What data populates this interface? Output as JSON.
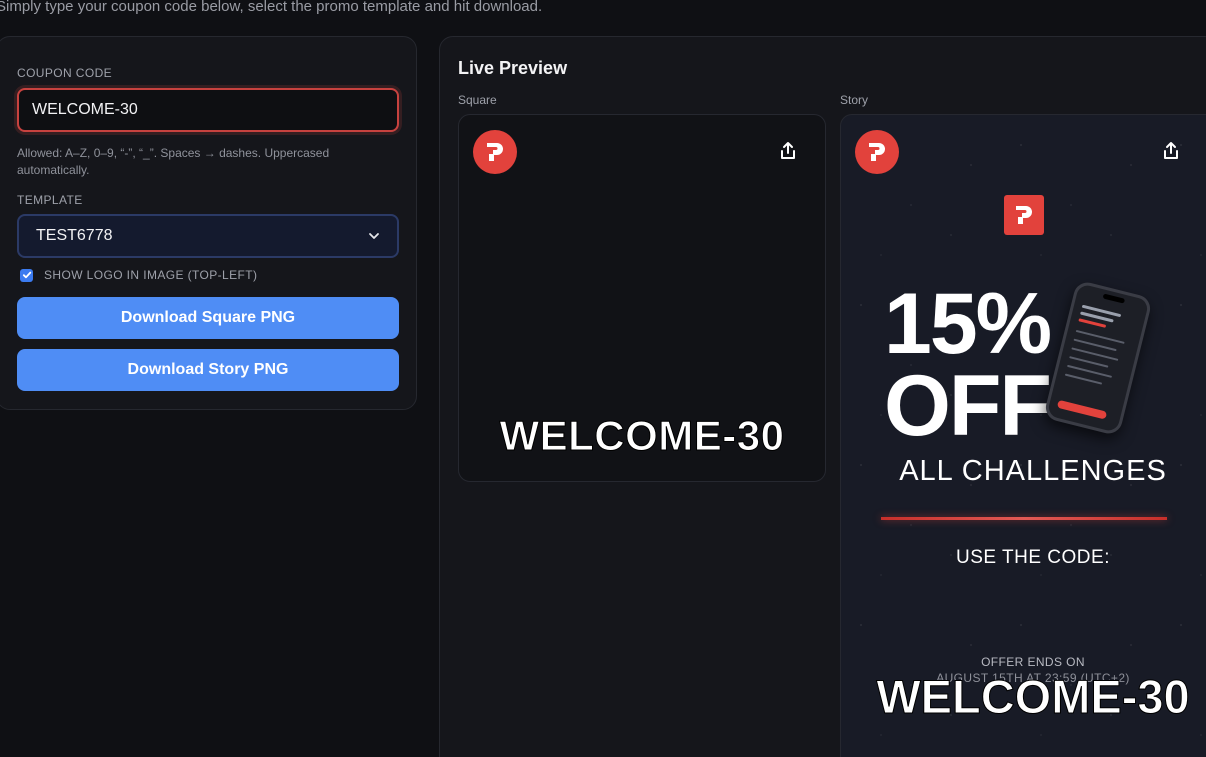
{
  "intro_text": "Simply type your coupon code below, select the promo template and hit download.",
  "form": {
    "coupon_label": "COUPON CODE",
    "coupon_value": "WELCOME-30",
    "help_text": "Allowed: A–Z, 0–9, “-”, “_”. Spaces → dashes. Uppercased automatically.",
    "template_label": "TEMPLATE",
    "template_value": "TEST6778",
    "show_logo_label": "SHOW LOGO IN IMAGE (TOP-LEFT)",
    "show_logo_checked": true,
    "download_square": "Download Square PNG",
    "download_story": "Download Story PNG"
  },
  "preview": {
    "title": "Live Preview",
    "square_label": "Square",
    "story_label": "Story",
    "square_code": "WELCOME-30",
    "story": {
      "percent": "15%",
      "off": "OFF",
      "subtitle": "ALL CHALLENGES",
      "use_code": "USE THE CODE:",
      "offer_ends": "OFFER ENDS ON",
      "offer_date": "AUGUST 15TH AT 23:59 (UTC+2)",
      "code": "WELCOME-30"
    }
  },
  "colors": {
    "brand_red": "#e2423c",
    "button_blue": "#4f8df5",
    "input_error": "#c7423f"
  },
  "icons": [
    "brand-logo-icon",
    "share-icon",
    "chevron-down-icon",
    "check-icon"
  ]
}
